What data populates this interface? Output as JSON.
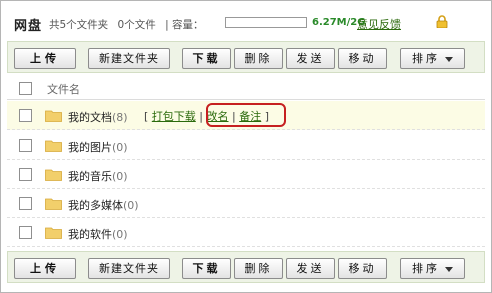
{
  "header": {
    "title": "网盘",
    "folder_count": "共5个文件夹",
    "file_count": "0个文件",
    "capacity_label": "| 容量：",
    "quota_used_fraction": 0.0,
    "quota_text": "6.27M/2G",
    "feedback_label": "意见反馈"
  },
  "toolbar": {
    "upload": "上传",
    "new_folder": "新建文件夹",
    "download": "下载",
    "delete": "删除",
    "send": "发送",
    "move": "移动",
    "sort": "排序"
  },
  "list": {
    "column_name": "文件名",
    "rows": [
      {
        "name": "我的文档",
        "count": "(8)"
      },
      {
        "name": "我的图片",
        "count": "(0)"
      },
      {
        "name": "我的音乐",
        "count": "(0)"
      },
      {
        "name": "我的多媒体",
        "count": "(0)"
      },
      {
        "name": "我的软件",
        "count": "(0)"
      }
    ],
    "actions": {
      "open_bracket": "[",
      "pack_download": "打包下载",
      "sep1": "|",
      "rename": "改名",
      "sep2": "|",
      "note": "备注",
      "close_bracket": "]"
    }
  },
  "colors": {
    "accent_green": "#2b6a0c",
    "toolbar_bg": "#eef3e6",
    "highlight": "#c62020",
    "folder": "#f2cf6b"
  }
}
